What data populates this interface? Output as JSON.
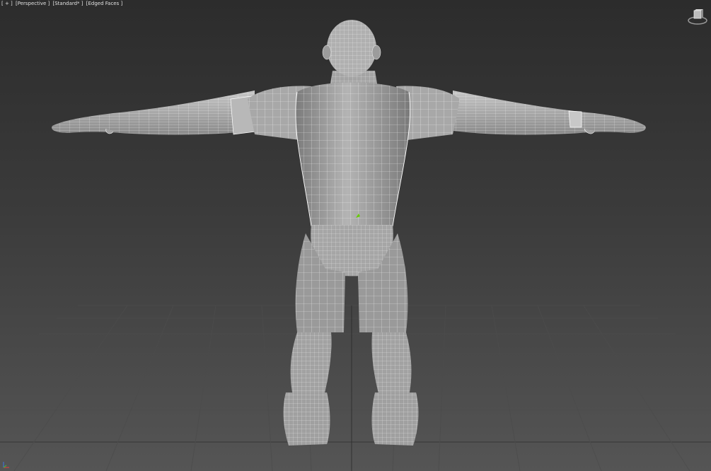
{
  "viewport": {
    "menu_plus": "[ + ]",
    "view_mode": "[Perspective ]",
    "shading_mode": "[Standard* ]",
    "display_mode": "[Edged Faces ]"
  },
  "icons": {
    "viewcube": "viewcube-icon",
    "axis": "axis-tripod-icon"
  },
  "colors": {
    "background_top": "#2c2c2c",
    "background_bottom": "#555555",
    "grid": "#4a4a4a",
    "model_fill": "#9a9a9a",
    "wireframe": "#ffffff",
    "pivot": "#66cc00"
  }
}
